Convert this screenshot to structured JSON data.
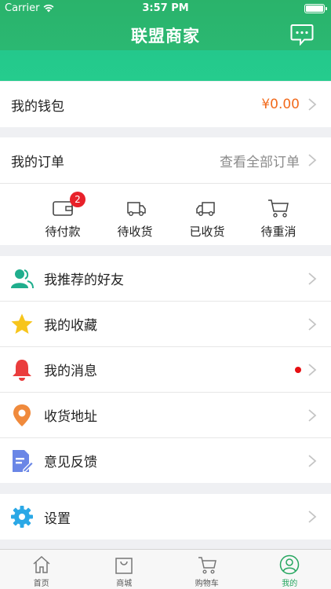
{
  "status_bar": {
    "carrier": "Carrier",
    "time": "3:57 PM"
  },
  "navbar": {
    "title": "联盟商家",
    "message_icon": "chat-bubble-icon"
  },
  "wallet": {
    "label": "我的钱包",
    "value": "¥0.00"
  },
  "orders": {
    "label": "我的订单",
    "view_all": "查看全部订单",
    "statuses": [
      {
        "label": "待付款",
        "icon": "wallet-icon",
        "badge": "2"
      },
      {
        "label": "待收货",
        "icon": "truck-icon"
      },
      {
        "label": "已收货",
        "icon": "truck-icon"
      },
      {
        "label": "待重消",
        "icon": "cart-icon"
      }
    ]
  },
  "menu": [
    {
      "label": "我推荐的好友",
      "icon": "friends-icon",
      "color": "#1fae8d"
    },
    {
      "label": "我的收藏",
      "icon": "star-icon",
      "color": "#f7c51c"
    },
    {
      "label": "我的消息",
      "icon": "bell-icon",
      "color": "#ea3d3d",
      "has_dot": true
    },
    {
      "label": "收货地址",
      "icon": "location-pin-icon",
      "color": "#f08a3c"
    },
    {
      "label": "意见反馈",
      "icon": "feedback-icon",
      "color": "#6a86e6"
    }
  ],
  "settings": {
    "label": "设置",
    "icon": "gear-icon",
    "color": "#2ba8e6"
  },
  "tabbar": {
    "tabs": [
      {
        "label": "首页",
        "icon": "home-icon"
      },
      {
        "label": "商城",
        "icon": "shopping-bag-icon"
      },
      {
        "label": "购物车",
        "icon": "cart-icon"
      },
      {
        "label": "我的",
        "icon": "profile-icon",
        "active": true
      }
    ]
  },
  "colors": {
    "primary": "#2bb872",
    "accent": "#f26b1d",
    "badge": "#e8212a"
  }
}
